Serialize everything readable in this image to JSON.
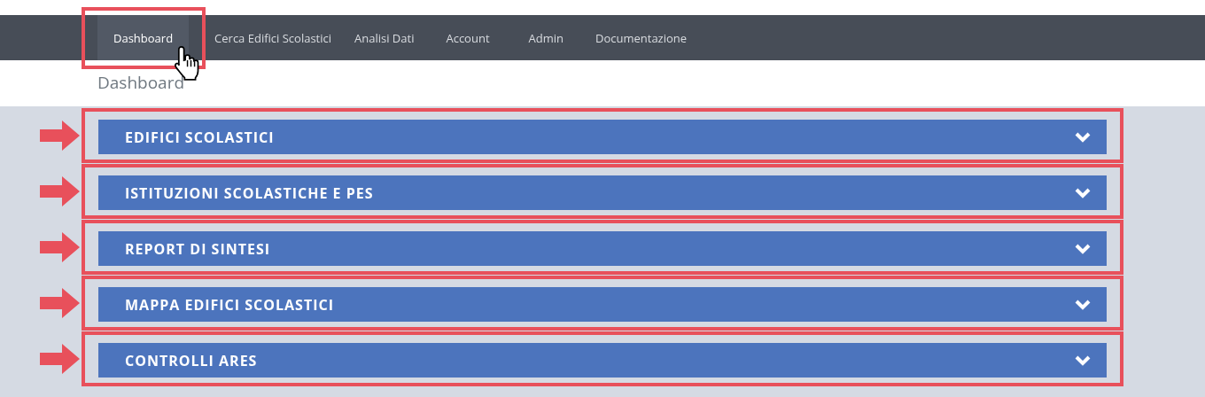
{
  "nav": {
    "items": [
      {
        "label": "Dashboard",
        "selected": true,
        "highlighted": true
      },
      {
        "label": "Cerca Edifici Scolastici",
        "selected": false,
        "highlighted": false
      },
      {
        "label": "Analisi Dati",
        "selected": false,
        "highlighted": false
      },
      {
        "label": "Account",
        "selected": false,
        "highlighted": false
      },
      {
        "label": "Admin",
        "selected": false,
        "highlighted": false
      },
      {
        "label": "Documentazione",
        "selected": false,
        "highlighted": false
      }
    ]
  },
  "page_title": "Dashboard",
  "panels": [
    {
      "title": "EDIFICI SCOLASTICI",
      "expanded": false,
      "highlighted": true
    },
    {
      "title": "ISTITUZIONI SCOLASTICHE E PES",
      "expanded": false,
      "highlighted": true
    },
    {
      "title": "REPORT DI SINTESI",
      "expanded": false,
      "highlighted": true
    },
    {
      "title": "MAPPA EDIFICI SCOLASTICI",
      "expanded": false,
      "highlighted": true
    },
    {
      "title": "CONTROLLI ARES",
      "expanded": false,
      "highlighted": true
    }
  ]
}
